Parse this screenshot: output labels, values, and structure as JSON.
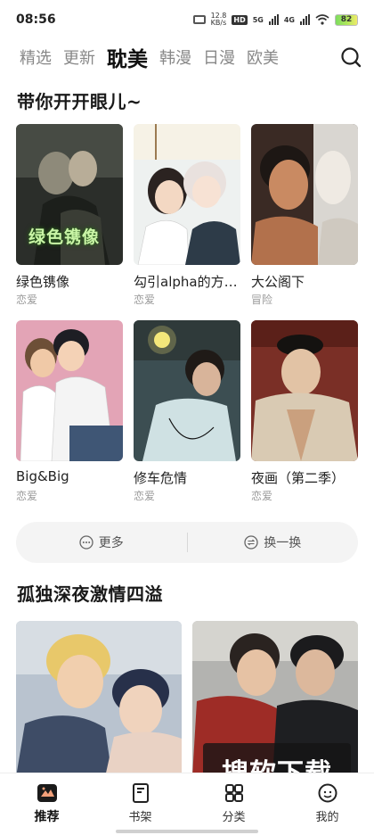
{
  "status_bar": {
    "time": "08:56",
    "speed_value": "12.8",
    "speed_unit": "KB/s",
    "hd_badge": "HD",
    "net_5g": "5G",
    "net_4g": "4G",
    "battery": "82"
  },
  "tabs": [
    {
      "label": "精选",
      "active": false
    },
    {
      "label": "更新",
      "active": false
    },
    {
      "label": "耽美",
      "active": true
    },
    {
      "label": "韩漫",
      "active": false
    },
    {
      "label": "日漫",
      "active": false
    },
    {
      "label": "欧美",
      "active": false
    }
  ],
  "section1": {
    "title": "带你开开眼儿~",
    "items": [
      {
        "title": "绿色镌像",
        "tag": "恋爱",
        "cover_text": "绿色镌像"
      },
      {
        "title": "勾引alpha的方…",
        "tag": "恋爱"
      },
      {
        "title": "大公阁下",
        "tag": "冒险"
      },
      {
        "title": "Big&Big",
        "tag": "恋爱"
      },
      {
        "title": "修车危情",
        "tag": "恋爱"
      },
      {
        "title": "夜画（第二季）",
        "tag": "恋爱"
      }
    ]
  },
  "actions": {
    "more_label": "更多",
    "refresh_label": "换一换"
  },
  "section2": {
    "title": "孤独深夜激情四溢"
  },
  "watermark": "搜软下载",
  "bottom_nav": [
    {
      "label": "推荐",
      "icon": "recommend-icon",
      "active": true
    },
    {
      "label": "书架",
      "icon": "bookshelf-icon",
      "active": false
    },
    {
      "label": "分类",
      "icon": "category-icon",
      "active": false
    },
    {
      "label": "我的",
      "icon": "profile-icon",
      "active": false
    }
  ],
  "colors": {
    "title_highlight": "#f2a07a",
    "active_tab": "#111111",
    "inactive_tab": "#888888"
  }
}
